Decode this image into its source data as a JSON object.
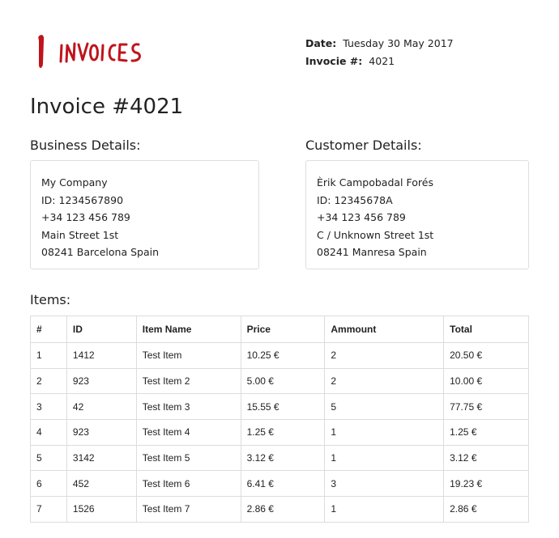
{
  "logo": {
    "text": "INVOICES",
    "color": "#c0141c"
  },
  "meta": {
    "date_label": "Date:",
    "date_value": "Tuesday 30 May 2017",
    "invoice_label": "Invocie #:",
    "invoice_value": "4021"
  },
  "title": "Invoice #4021",
  "business": {
    "heading": "Business Details:",
    "lines": [
      "My Company",
      "ID: 1234567890",
      "+34 123 456 789",
      "Main Street 1st",
      "08241 Barcelona Spain"
    ]
  },
  "customer": {
    "heading": "Customer Details:",
    "lines": [
      "Èrik Campobadal Forés",
      "ID: 12345678A",
      "+34 123 456 789",
      "C / Unknown Street 1st",
      "08241 Manresa Spain"
    ]
  },
  "items": {
    "heading": "Items:",
    "columns": [
      "#",
      "ID",
      "Item Name",
      "Price",
      "Ammount",
      "Total"
    ],
    "rows": [
      [
        "1",
        "1412",
        "Test Item",
        "10.25 €",
        "2",
        "20.50 €"
      ],
      [
        "2",
        "923",
        "Test Item 2",
        "5.00 €",
        "2",
        "10.00 €"
      ],
      [
        "3",
        "42",
        "Test Item 3",
        "15.55 €",
        "5",
        "77.75 €"
      ],
      [
        "4",
        "923",
        "Test Item 4",
        "1.25 €",
        "1",
        "1.25 €"
      ],
      [
        "5",
        "3142",
        "Test Item 5",
        "3.12 €",
        "1",
        "3.12 €"
      ],
      [
        "6",
        "452",
        "Test Item 6",
        "6.41 €",
        "3",
        "19.23 €"
      ],
      [
        "7",
        "1526",
        "Test Item 7",
        "2.86 €",
        "1",
        "2.86 €"
      ]
    ]
  }
}
